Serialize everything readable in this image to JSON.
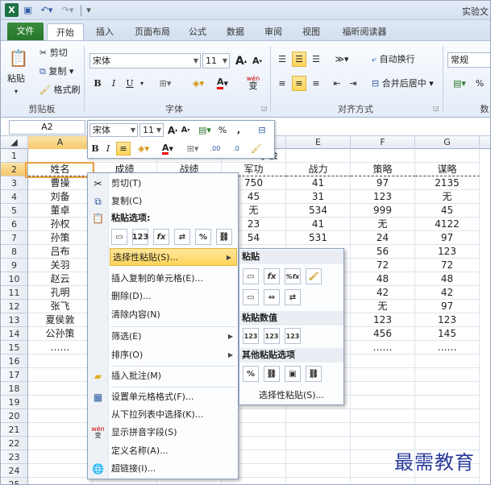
{
  "title": {
    "app_icon": "X",
    "window_title": "实验文"
  },
  "tabs": [
    "文件",
    "开始",
    "插入",
    "页面布局",
    "公式",
    "数据",
    "审阅",
    "视图",
    "福昕阅读器"
  ],
  "ribbon": {
    "clipboard": {
      "paste": "粘贴",
      "cut": "剪切",
      "copy": "复制",
      "format_painter": "格式刷",
      "group": "剪贴板"
    },
    "font": {
      "name": "宋体",
      "size": "11",
      "group": "字体",
      "bold": "B",
      "italic": "I",
      "underline": "U",
      "grow": "A",
      "shrink": "A",
      "wen": "wén",
      "wen_sub": "变"
    },
    "align": {
      "wrap": "自动换行",
      "merge": "合并后居中",
      "group": "对齐方式"
    },
    "number": {
      "format": "常规",
      "group": "数",
      "pct": "%"
    }
  },
  "namebox": "A2",
  "columns": [
    "A",
    "B",
    "C",
    "D",
    "E",
    "F",
    "G"
  ],
  "header_extra": "学会",
  "rows": [
    {
      "n": "1",
      "cells": [
        "",
        "",
        "",
        "",
        "",
        "",
        ""
      ]
    },
    {
      "n": "2",
      "cells": [
        "姓名",
        "成绩",
        "战绩",
        "军功",
        "战力",
        "策略",
        "谋略"
      ]
    },
    {
      "n": "3",
      "cells": [
        "曹操",
        "",
        "",
        "750",
        "41",
        "97",
        "2135"
      ]
    },
    {
      "n": "4",
      "cells": [
        "刘备",
        "",
        "",
        "45",
        "31",
        "123",
        "无"
      ]
    },
    {
      "n": "5",
      "cells": [
        "董卓",
        "",
        "",
        "无",
        "534",
        "999",
        "45"
      ]
    },
    {
      "n": "6",
      "cells": [
        "孙权",
        "",
        "",
        "23",
        "41",
        "无",
        "4122"
      ]
    },
    {
      "n": "7",
      "cells": [
        "孙策",
        "",
        "",
        "54",
        "531",
        "24",
        "97"
      ]
    },
    {
      "n": "8",
      "cells": [
        "吕布",
        "",
        "",
        "",
        "",
        "56",
        "123"
      ]
    },
    {
      "n": "9",
      "cells": [
        "关羽",
        "",
        "",
        "",
        "",
        "72",
        "72"
      ]
    },
    {
      "n": "10",
      "cells": [
        "赵云",
        "",
        "",
        "",
        "",
        "48",
        "48"
      ]
    },
    {
      "n": "11",
      "cells": [
        "孔明",
        "",
        "",
        "",
        "",
        "42",
        "42"
      ]
    },
    {
      "n": "12",
      "cells": [
        "张飞",
        "",
        "",
        "",
        "",
        "无",
        "97"
      ]
    },
    {
      "n": "13",
      "cells": [
        "夏侯敦",
        "",
        "",
        "",
        "",
        "123",
        "123"
      ]
    },
    {
      "n": "14",
      "cells": [
        "公孙策",
        "",
        "",
        "",
        "",
        "456",
        "145"
      ]
    },
    {
      "n": "15",
      "cells": [
        "……",
        "",
        "",
        "",
        "",
        "……",
        "……"
      ]
    },
    {
      "n": "16",
      "cells": [
        "",
        "",
        "",
        "",
        "",
        "",
        ""
      ]
    },
    {
      "n": "17",
      "cells": [
        "",
        "",
        "",
        "",
        "",
        "",
        ""
      ]
    },
    {
      "n": "18",
      "cells": [
        "",
        "",
        "",
        "",
        "",
        "",
        ""
      ]
    },
    {
      "n": "19",
      "cells": [
        "",
        "",
        "",
        "",
        "",
        "",
        ""
      ]
    },
    {
      "n": "20",
      "cells": [
        "",
        "",
        "",
        "",
        "",
        "",
        ""
      ]
    },
    {
      "n": "21",
      "cells": [
        "",
        "",
        "",
        "",
        "",
        "",
        ""
      ]
    },
    {
      "n": "22",
      "cells": [
        "",
        "",
        "",
        "",
        "",
        "",
        ""
      ]
    },
    {
      "n": "23",
      "cells": [
        "",
        "",
        "",
        "",
        "",
        "",
        ""
      ]
    },
    {
      "n": "24",
      "cells": [
        "",
        "",
        "",
        "",
        "",
        "",
        ""
      ]
    },
    {
      "n": "25",
      "cells": [
        "",
        "",
        "",
        "",
        "",
        "",
        ""
      ]
    }
  ],
  "mini": {
    "font": "宋体",
    "size": "11",
    "pct": "%",
    "comma": ",",
    "dec1": ".00",
    "dec2": ".0"
  },
  "context_menu": {
    "cut": "剪切(T)",
    "copy": "复制(C)",
    "paste_options": "粘贴选项:",
    "paste_special": "选择性粘贴(S)...",
    "insert_copied": "插入复制的单元格(E)...",
    "delete": "删除(D)...",
    "clear": "清除内容(N)",
    "filter": "筛选(E)",
    "sort": "排序(O)",
    "insert_comment": "插入批注(M)",
    "format_cells": "设置单元格格式(F)...",
    "pick_list": "从下拉列表中选择(K)...",
    "phonetic": "显示拼音字段(S)",
    "define_name": "定义名称(A)...",
    "hyperlink": "超链接(I)...",
    "paste_buttons": [
      "",
      "123",
      "fx",
      "",
      "%",
      ""
    ]
  },
  "submenu": {
    "paste": "粘贴",
    "paste_values": "粘贴数值",
    "other": "其他粘贴选项",
    "paste_special": "选择性粘贴(S)...",
    "row1": [
      "",
      "fx",
      "%fx",
      ""
    ],
    "row2": [
      "",
      "",
      ""
    ],
    "values": [
      "123",
      "123",
      "123"
    ],
    "others": [
      "%",
      "",
      "",
      ""
    ]
  },
  "watermark": "最需教育"
}
